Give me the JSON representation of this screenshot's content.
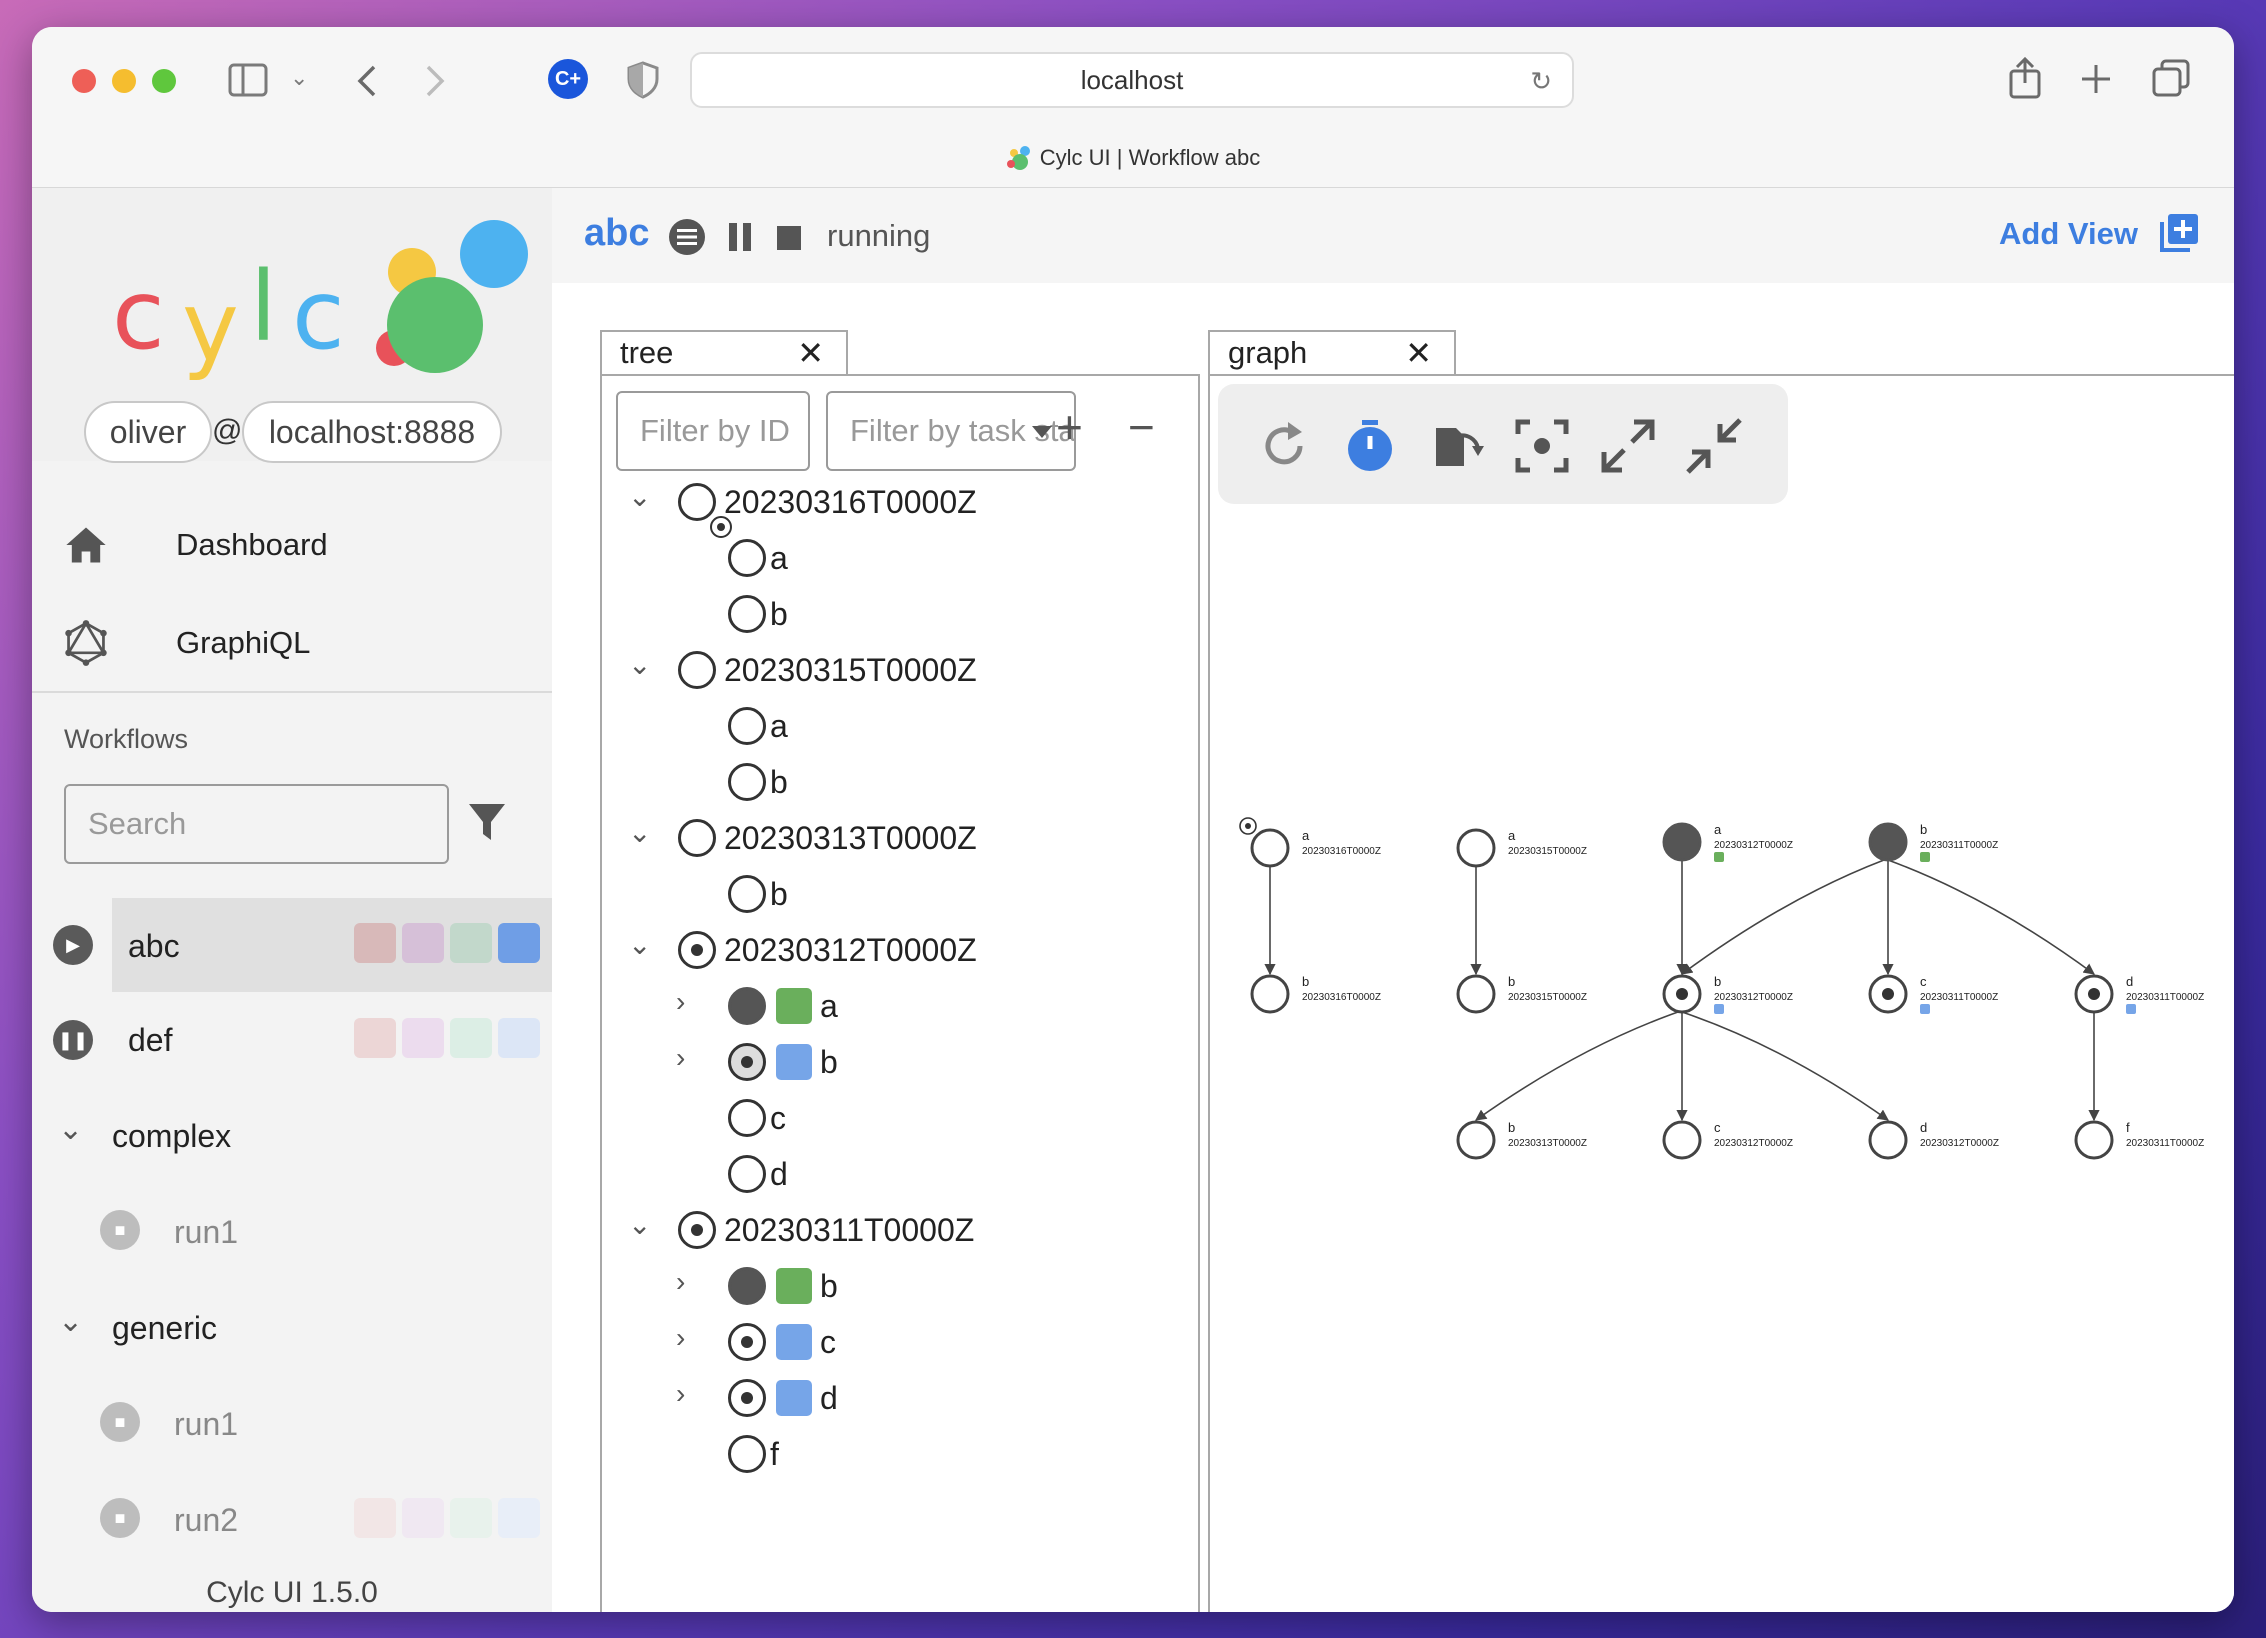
{
  "browser": {
    "url": "localhost",
    "tab_title": "Cylc UI | Workflow abc"
  },
  "sidebar": {
    "logo": "cylc",
    "user": "oliver",
    "at": "@",
    "host": "localhost:8888",
    "nav": [
      {
        "label": "Dashboard",
        "icon": "home-icon"
      },
      {
        "label": "GraphiQL",
        "icon": "graphql-icon"
      }
    ],
    "workflows_label": "Workflows",
    "search_placeholder": "Search",
    "workflows": [
      {
        "name": "abc",
        "status": "running"
      },
      {
        "name": "def",
        "status": "paused"
      },
      {
        "name": "complex",
        "group": true
      },
      {
        "name": "run1",
        "status": "stopped"
      },
      {
        "name": "generic",
        "group": true
      },
      {
        "name": "run1",
        "status": "stopped"
      },
      {
        "name": "run2",
        "status": "stopped"
      }
    ],
    "version": "Cylc UI 1.5.0"
  },
  "toolbar": {
    "workflow_name": "abc",
    "status": "running",
    "add_view": "Add View"
  },
  "tree_view": {
    "tab_label": "tree",
    "filter_id_placeholder": "Filter by ID",
    "filter_state_placeholder": "Filter by task state",
    "cycles": [
      {
        "label": "20230316T0000Z",
        "tasks": [
          "a",
          "b"
        ]
      },
      {
        "label": "20230315T0000Z",
        "tasks": [
          "a",
          "b"
        ]
      },
      {
        "label": "20230313T0000Z",
        "tasks": [
          "b"
        ]
      },
      {
        "label": "20230312T0000Z",
        "tasks": [
          "a",
          "b",
          "c",
          "d"
        ]
      },
      {
        "label": "20230311T0000Z",
        "tasks": [
          "b",
          "c",
          "d",
          "f"
        ]
      }
    ]
  },
  "graph_view": {
    "tab_label": "graph",
    "nodes": [
      {
        "name": "a",
        "cycle": "20230316T0000Z"
      },
      {
        "name": "a",
        "cycle": "20230315T0000Z"
      },
      {
        "name": "a",
        "cycle": "20230312T0000Z"
      },
      {
        "name": "b",
        "cycle": "20230311T0000Z"
      },
      {
        "name": "b",
        "cycle": "20230316T0000Z"
      },
      {
        "name": "b",
        "cycle": "20230315T0000Z"
      },
      {
        "name": "b",
        "cycle": "20230312T0000Z"
      },
      {
        "name": "c",
        "cycle": "20230311T0000Z"
      },
      {
        "name": "d",
        "cycle": "20230311T0000Z"
      },
      {
        "name": "b",
        "cycle": "20230313T0000Z"
      },
      {
        "name": "c",
        "cycle": "20230312T0000Z"
      },
      {
        "name": "d",
        "cycle": "20230312T0000Z"
      },
      {
        "name": "f",
        "cycle": "20230311T0000Z"
      }
    ]
  },
  "colors": {
    "accent": "#3d7ee0",
    "succeeded_job": "#6aaf5c",
    "running_job": "#76a5e8"
  }
}
